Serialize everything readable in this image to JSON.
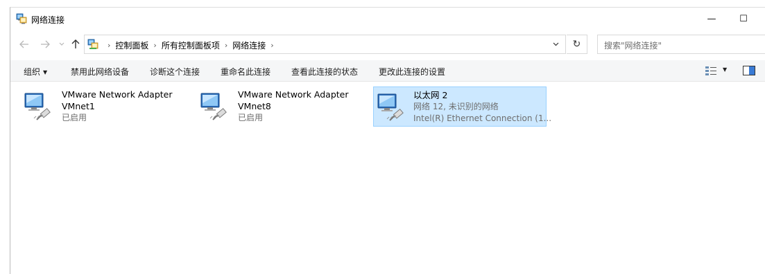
{
  "window": {
    "title": "网络连接",
    "minimize_glyph": "—",
    "maximize_glyph": "☐"
  },
  "nav": {
    "back_icon": "arrow-left-icon",
    "forward_icon": "arrow-right-icon",
    "up_icon": "arrow-up-icon",
    "breadcrumbs": [
      "控制面板",
      "所有控制面板项",
      "网络连接"
    ],
    "refresh_glyph": "↻",
    "search_placeholder": "搜索\"网络连接\""
  },
  "commands": {
    "organize": "组织",
    "disable": "禁用此网络设备",
    "diagnose": "诊断这个连接",
    "rename": "重命名此连接",
    "status": "查看此连接的状态",
    "settings": "更改此连接的设置"
  },
  "connections": [
    {
      "name": "VMware Network Adapter",
      "line2": "VMnet1",
      "line3": "已启用",
      "selected": false
    },
    {
      "name": "VMware Network Adapter",
      "line2": "VMnet8",
      "line3": "已启用",
      "selected": false
    },
    {
      "name": "以太网 2",
      "line2": "网络 12, 未识别的网络",
      "line3": "Intel(R) Ethernet Connection (1...",
      "selected": true
    }
  ],
  "colors": {
    "selection_bg": "#cce8ff",
    "selection_border": "#99d1ff",
    "command_bar_bg": "#f5f6f7",
    "muted_text": "#6d6d6d"
  }
}
